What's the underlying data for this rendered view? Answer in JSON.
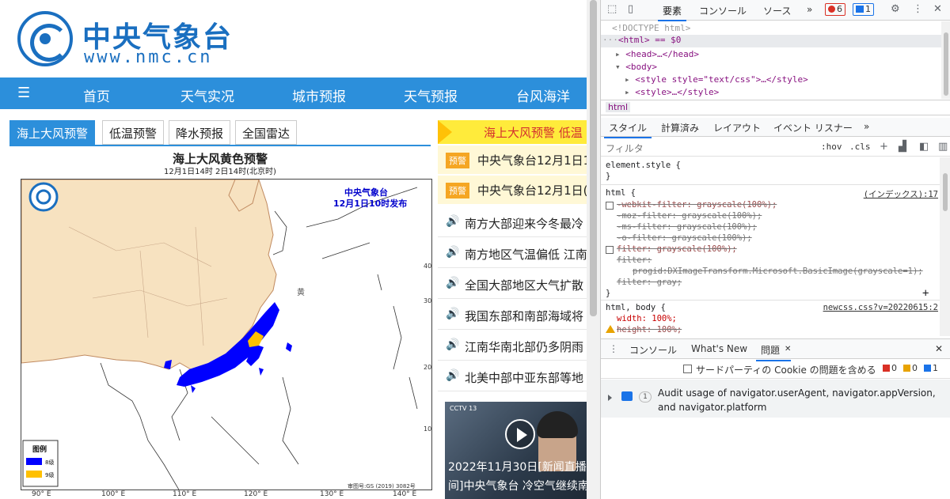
{
  "site": {
    "title": "中央气象台",
    "url": "www.nmc.cn"
  },
  "nav": {
    "menu_icon": "hamburger-icon",
    "items": [
      "首页",
      "天气实况",
      "城市预报",
      "天气预报",
      "台风海洋"
    ]
  },
  "tabs": [
    "海上大风预警",
    "低温预警",
    "降水预报",
    "全国雷达"
  ],
  "map": {
    "title": "海上大风黄色预警",
    "subtitle": "12月1日14时 2日14时(北京时)",
    "stamp_line1": "中央气象台",
    "stamp_line2": "12月1日10时发布",
    "legend_title": "图例",
    "legend": [
      {
        "label": "8级",
        "color": "#0000ff"
      },
      {
        "label": "9级",
        "color": "#ffc000"
      }
    ],
    "approval": "审图号:GS (2019) 3082号",
    "lon_ticks": [
      "90° E",
      "100° E",
      "110° E",
      "120° E",
      "130° E",
      "140° E"
    ],
    "lat_ticks": [
      "40",
      "30",
      "20",
      "10"
    ],
    "sea_label": "黄",
    "land_color": "#f7e2c0",
    "wind8_color": "#0000ff",
    "wind9_color": "#ffc000"
  },
  "side": {
    "alert": "海上大风预警  低温",
    "badge": "预警",
    "yellow_news": [
      "中央气象台12月1日1",
      "中央气象台12月1日("
    ],
    "news": [
      "南方大部迎来今冬最冷",
      "南方地区气温偏低 江南",
      "全国大部地区大气扩散",
      "我国东部和南部海域将",
      "江南华南北部仍多阴雨",
      "北美中部中亚东部等地"
    ],
    "video": {
      "channel": "CCTV 13",
      "caption1": "2022年11月30日[新闻直播",
      "caption2": "间]中央气象台 冷空气继续南"
    }
  },
  "devtools": {
    "tabs": [
      "要素",
      "コンソール",
      "ソース"
    ],
    "more": "»",
    "errors": "6",
    "messages": "1",
    "dom_lines": [
      "<!DOCTYPE html>",
      "<html> == $0",
      "<head>…</head>",
      "<body>",
      "<style style=\"text/css\">…</style>",
      "<style>…</style>"
    ],
    "breadcrumb": "html",
    "subtabs": [
      "スタイル",
      "計算済み",
      "レイアウト",
      "イベント リスナー"
    ],
    "filter_placeholder": "フィルタ",
    "hov": ":hov",
    "cls": ".cls",
    "element_style": "element.style {",
    "close_brace": "}",
    "rule1_selector": "html {",
    "rule1_source": "(インデックス):17",
    "rule1_props": [
      "-webkit-filter: grayscale(100%);",
      "-moz-filter: grayscale(100%);",
      "-ms-filter: grayscale(100%);",
      "-o-filter: grayscale(100%);",
      "filter: grayscale(100%);",
      "filter:",
      "progid:DXImageTransform.Microsoft.BasicImage(grayscale=1);",
      "filter: gray;"
    ],
    "rule2_selector": "html, body {",
    "rule2_source": "newcss.css?v=20220615:2",
    "rule2_props": [
      "width: 100%;",
      "height: 100%;"
    ],
    "drawer_tabs": [
      "コンソール",
      "What's New",
      "問題"
    ],
    "third_party_label": "サードパーティの Cookie の問題を含める",
    "counts": [
      "0",
      "0",
      "1"
    ],
    "issue_count": "1",
    "issue_text": "Audit usage of navigator.userAgent, navigator.appVersion, and navigator.platform"
  }
}
